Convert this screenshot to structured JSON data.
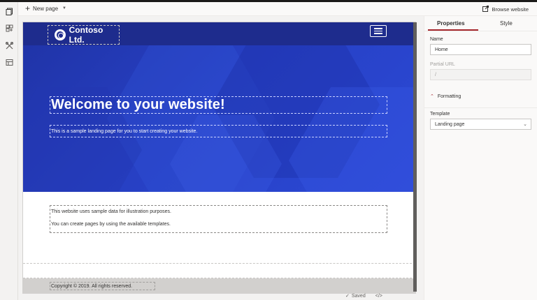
{
  "command_bar": {
    "new_page_label": "New page",
    "browse_label": "Browse website"
  },
  "rail": {
    "items": [
      {
        "icon": "pages-icon",
        "active": true
      },
      {
        "icon": "components-icon"
      },
      {
        "icon": "tools-icon"
      },
      {
        "icon": "data-icon"
      }
    ]
  },
  "site": {
    "logo_text": "Contoso Ltd.",
    "hero_title": "Welcome to your website!",
    "hero_subtitle": "This is a sample landing page for you to start creating your website.",
    "content_line_1": "This website uses sample data for illustration purposes.",
    "content_line_2": "You can create pages by using the available templates.",
    "footer_text": "Copyright © 2019. All rights reserved.",
    "header_color": "#1e2c8d",
    "hero_color": "#2740c4"
  },
  "status": {
    "saved_label": "Saved",
    "code_label": "</>"
  },
  "properties_pane": {
    "tab_properties": "Properties",
    "tab_style": "Style",
    "name_label": "Name",
    "name_value": "Home",
    "partial_url_label": "Partial URL",
    "partial_url_value": "/",
    "formatting_label": "Formatting",
    "template_label": "Template",
    "template_value": "Landing page",
    "accent_color": "#a4262c"
  }
}
